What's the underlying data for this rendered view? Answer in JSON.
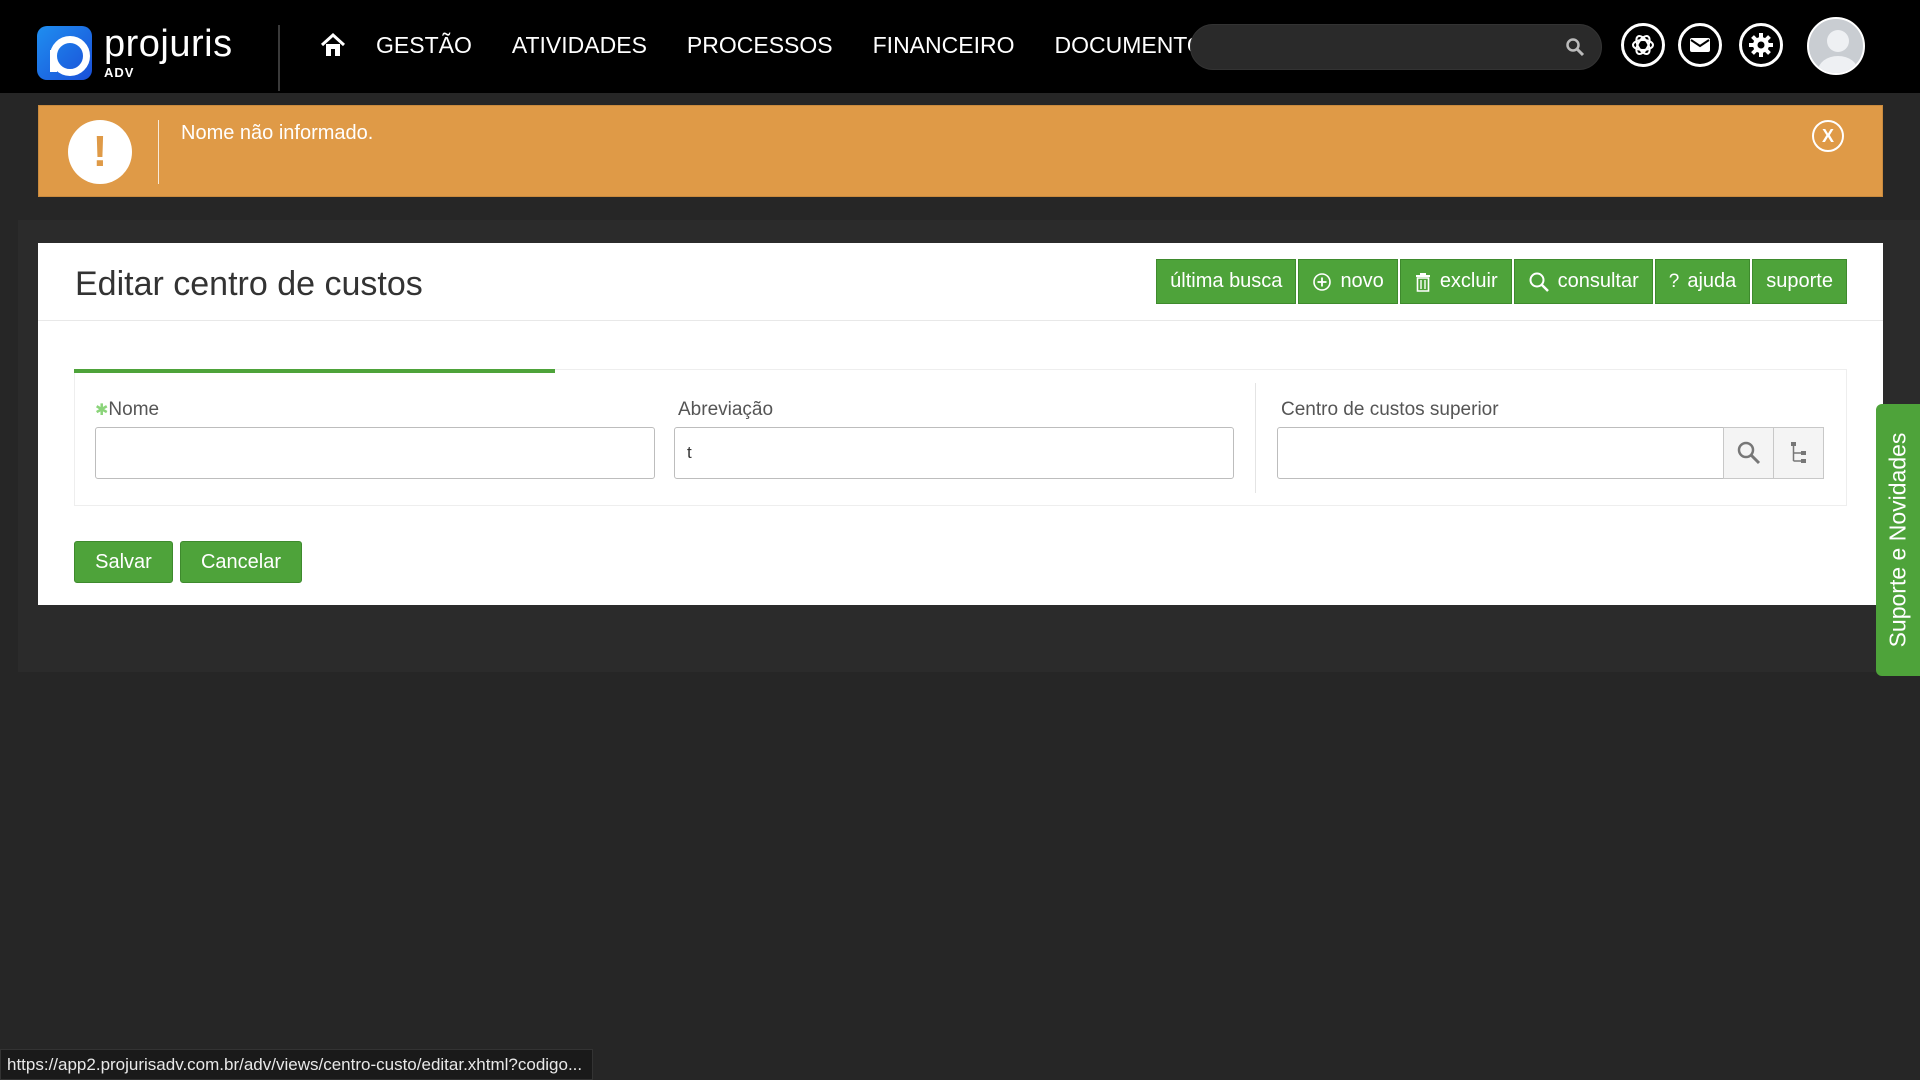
{
  "app": {
    "logo_word": "projuris",
    "logo_sub": "ADV"
  },
  "nav": {
    "items": [
      "GESTÃO",
      "ATIVIDADES",
      "PROCESSOS",
      "FINANCEIRO",
      "DOCUMENTOS"
    ]
  },
  "search": {
    "placeholder": ""
  },
  "alert": {
    "message": "Nome não informado.",
    "icon": "!",
    "close": "X"
  },
  "page": {
    "title": "Editar centro de custos"
  },
  "toolbar": {
    "ultima_busca": "última busca",
    "novo": "novo",
    "excluir": "excluir",
    "consultar": "consultar",
    "ajuda": "ajuda",
    "ajuda_icon": "?",
    "suporte": "suporte"
  },
  "form": {
    "nome": {
      "label": "Nome",
      "required_mark": "✱",
      "value": ""
    },
    "abreviacao": {
      "label": "Abreviação",
      "value": "t"
    },
    "centro_superior": {
      "label": "Centro de custos superior",
      "value": ""
    }
  },
  "actions": {
    "salvar": "Salvar",
    "cancelar": "Cancelar"
  },
  "side_tab": {
    "label": "Suporte e Novidades"
  },
  "status_bar": {
    "url": "https://app2.projurisadv.com.br/adv/views/centro-custo/editar.xhtml?codigo..."
  },
  "colors": {
    "accent_green": "#4ea33a",
    "alert_orange": "#df9a47",
    "topbar": "#000000",
    "background": "#262626"
  }
}
